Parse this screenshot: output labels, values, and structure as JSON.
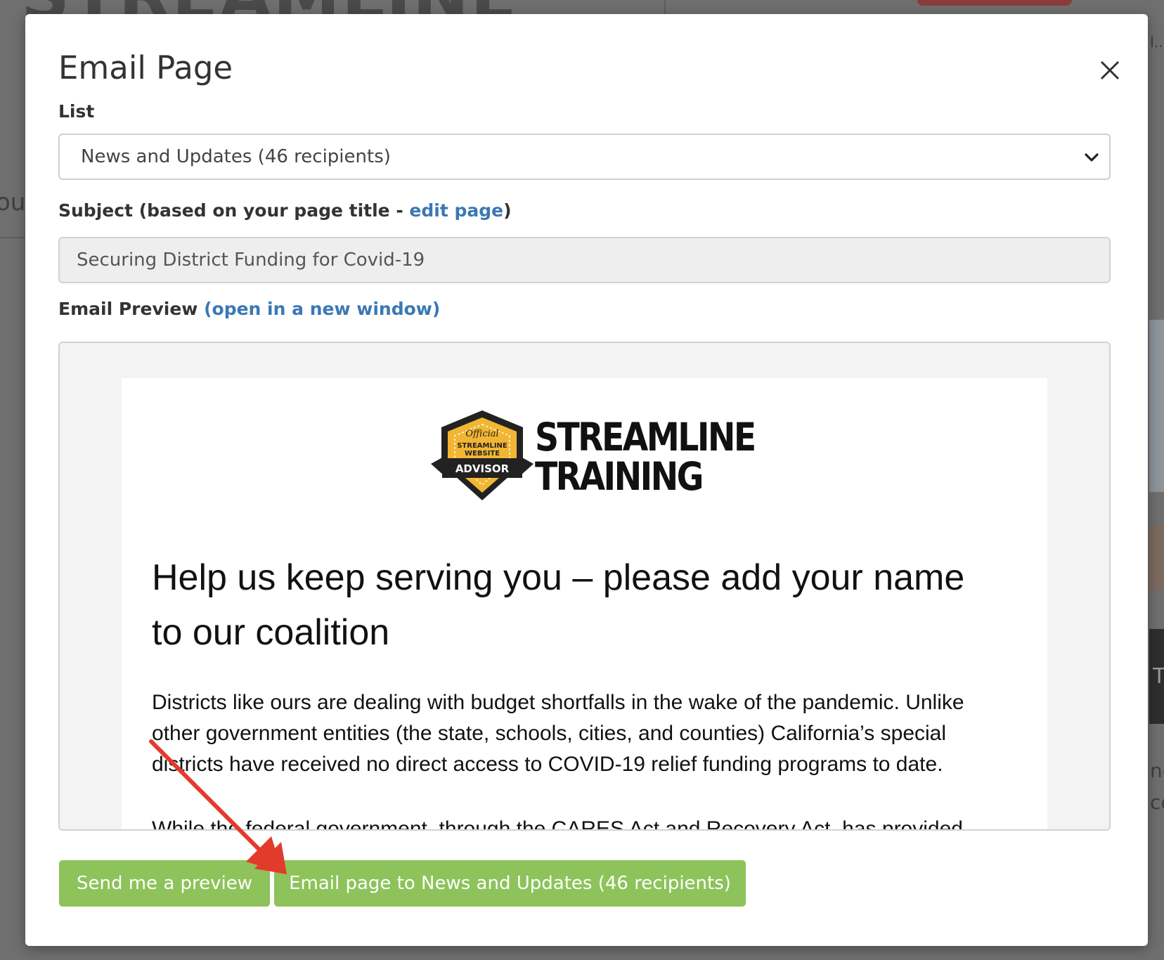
{
  "background": {
    "logo_fragment": "STREAMLINE",
    "side_fragment_left": "out",
    "side_fragment_right_1": "I...",
    "side_fragment_right_2": "ne",
    "side_fragment_right_3": "co",
    "side_fragment_right_4": "T"
  },
  "modal": {
    "title": "Email Page",
    "list_label": "List",
    "list_selected": "News and Updates (46 recipients)",
    "subject_label_prefix": "Subject (based on your page title - ",
    "subject_link": "edit page",
    "subject_label_suffix": ")",
    "subject_value": "Securing District Funding for Covid-19",
    "preview_label": "Email Preview",
    "preview_link": "(open in a new window)"
  },
  "email": {
    "brand_line1": "STREAMLINE",
    "brand_line2": "TRAINING",
    "badge_official": "Official",
    "badge_line1": "STREAMLINE",
    "badge_line2": "WEBSITE",
    "badge_ribbon": "ADVISOR",
    "heading": "Help us keep serving you – please add your name to our coalition",
    "body": "Districts like ours are dealing with budget shortfalls in the wake of the pandemic. Unlike other government entities (the state, schools, cities, and counties) California’s special districts have received no direct access to COVID-19 relief funding programs to date.",
    "body_cut": "While the federal government, through the CARES Act and Recovery Act, has provided"
  },
  "buttons": {
    "preview": "Send me a preview",
    "send": "Email page to News and Updates (46 recipients)"
  },
  "colors": {
    "accent_link": "#3b78b4",
    "button_green": "#8dc35a",
    "annotation_arrow": "#e23b2b",
    "badge_gold": "#f2b632"
  }
}
